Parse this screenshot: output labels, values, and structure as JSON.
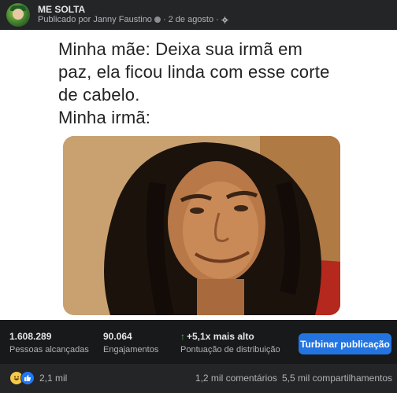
{
  "header": {
    "page_name": "ME SOLTA",
    "published_by": "Publicado por Janny Faustino",
    "separator": "·",
    "date": "2 de agosto",
    "separator2": "·"
  },
  "meme": {
    "caption": "Minha mãe: Deixa sua irmã em\npaz, ela ficou linda com esse corte\nde cabelo.\nMinha irmã:"
  },
  "insights": {
    "reach_value": "1.608.289",
    "reach_label": "Pessoas alcançadas",
    "engagement_value": "90.064",
    "engagement_label": "Engajamentos",
    "distribution_value": "+5,1x mais alto",
    "distribution_label": "Pontuação de distribuição",
    "boost_label": "Turbinar publicação"
  },
  "footer": {
    "reactions_count": "2,1 mil",
    "comments": "1,2 mil comentários",
    "shares": "5,5 mil compartilhamentos"
  },
  "colors": {
    "accent": "#2374e1",
    "positive": "#45bd62"
  },
  "icons": {
    "privacy": "globe-icon",
    "settings": "gear-icon",
    "up": "arrow-up-icon",
    "haha": "haha-reaction-icon",
    "like": "like-reaction-icon"
  }
}
